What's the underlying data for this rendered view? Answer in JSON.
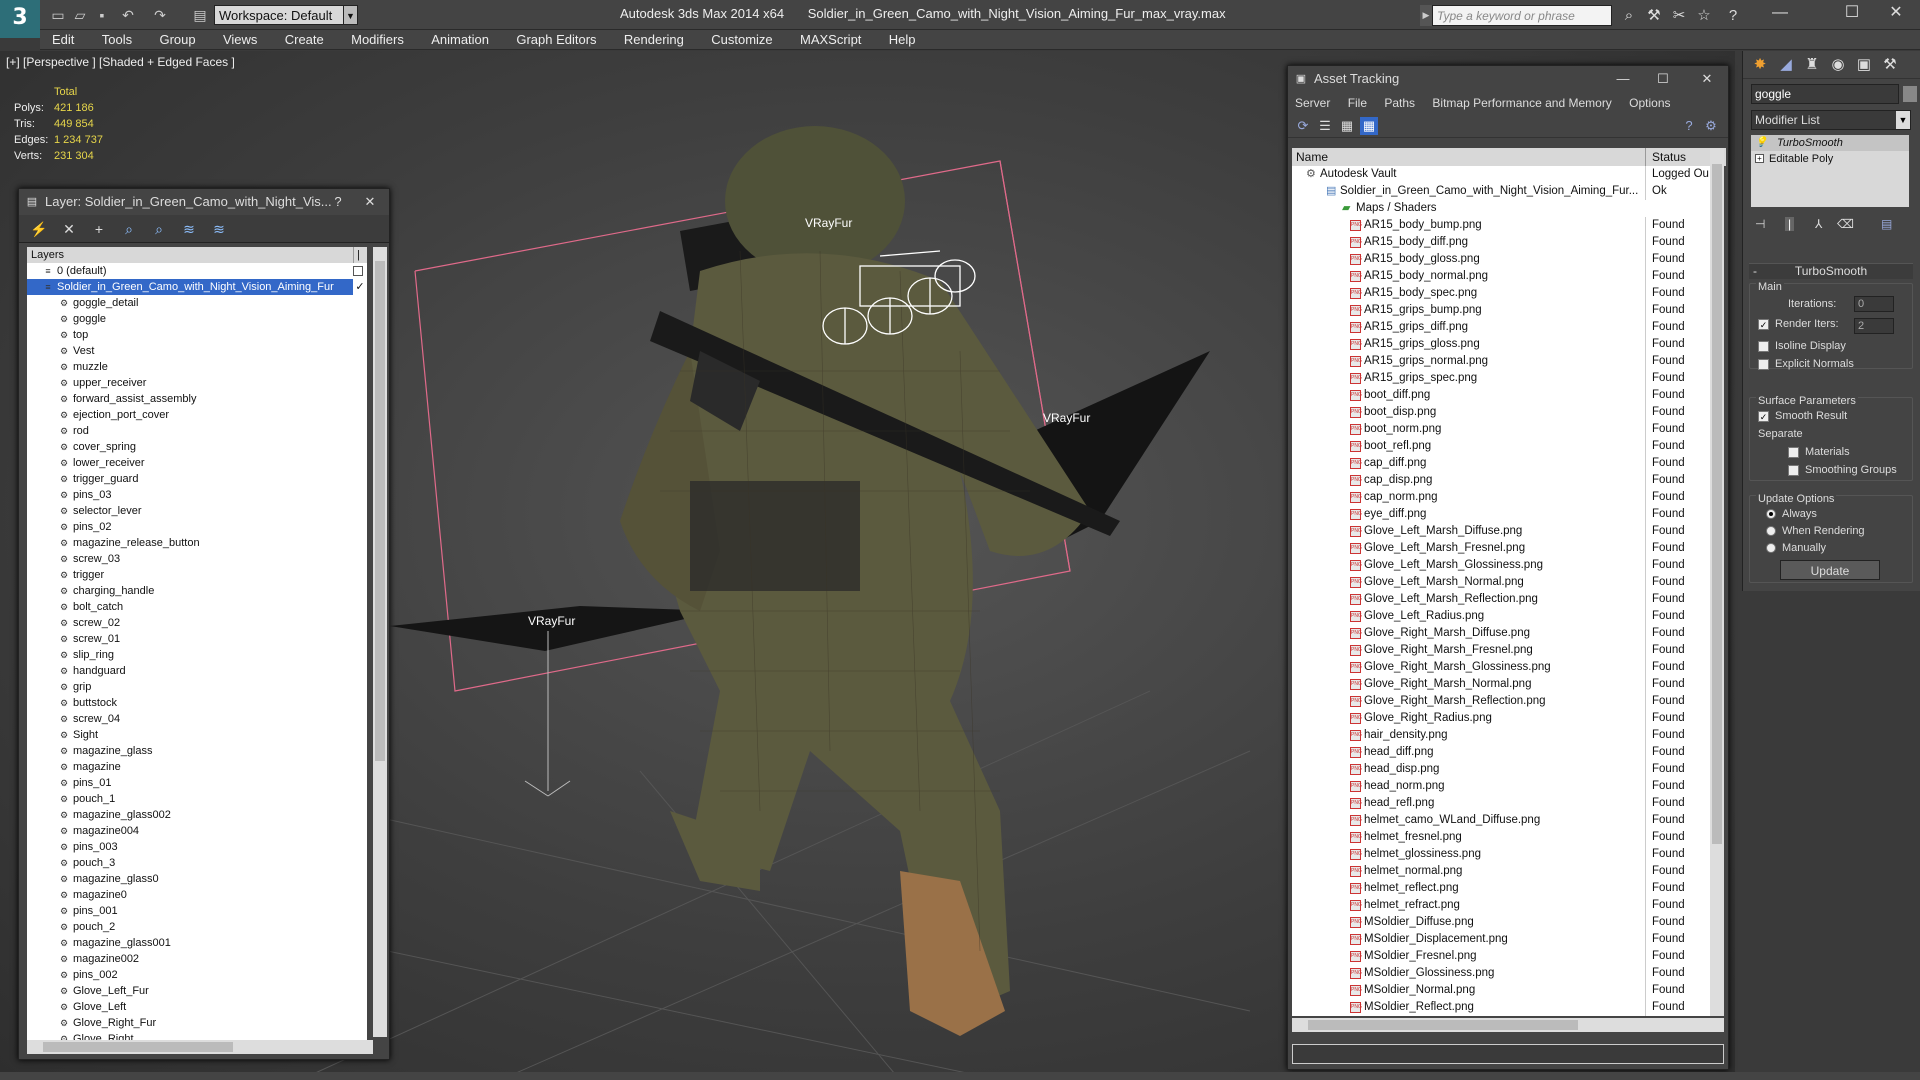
{
  "title": {
    "app": "Autodesk 3ds Max 2014 x64",
    "file": "Soldier_in_Green_Camo_with_Night_Vision_Aiming_Fur_max_vray.max"
  },
  "workspace": "Workspace: Default",
  "search": {
    "placeholder": "Type a keyword or phrase"
  },
  "menu": [
    "Edit",
    "Tools",
    "Group",
    "Views",
    "Create",
    "Modifiers",
    "Animation",
    "Graph Editors",
    "Rendering",
    "Customize",
    "MAXScript",
    "Help"
  ],
  "viewport": {
    "label": "[+] [Perspective ] [Shaded + Edged Faces ]",
    "stats": {
      "header": "Total",
      "polys_label": "Polys:",
      "polys": "421 186",
      "tris_label": "Tris:",
      "tris": "449 854",
      "edges_label": "Edges:",
      "edges": "1 234 737",
      "verts_label": "Verts:",
      "verts": "231 304"
    },
    "vray_labels": [
      "VRayFur",
      "VRayFur",
      "VRayFur"
    ]
  },
  "layer_panel": {
    "title": "Layer: Soldier_in_Green_Camo_with_Night_Vis...",
    "help": "?",
    "column": "Layers",
    "items": [
      {
        "label": "0 (default)",
        "kind": "layer"
      },
      {
        "label": "Soldier_in_Green_Camo_with_Night_Vision_Aiming_Fur",
        "kind": "layer-active"
      },
      {
        "label": "goggle_detail"
      },
      {
        "label": "goggle"
      },
      {
        "label": "top"
      },
      {
        "label": "Vest"
      },
      {
        "label": "muzzle"
      },
      {
        "label": "upper_receiver"
      },
      {
        "label": "forward_assist_assembly"
      },
      {
        "label": "ejection_port_cover"
      },
      {
        "label": "rod"
      },
      {
        "label": "cover_spring"
      },
      {
        "label": "lower_receiver"
      },
      {
        "label": "trigger_guard"
      },
      {
        "label": "pins_03"
      },
      {
        "label": "selector_lever"
      },
      {
        "label": "pins_02"
      },
      {
        "label": "magazine_release_button"
      },
      {
        "label": "screw_03"
      },
      {
        "label": "trigger"
      },
      {
        "label": "charging_handle"
      },
      {
        "label": "bolt_catch"
      },
      {
        "label": "screw_02"
      },
      {
        "label": "screw_01"
      },
      {
        "label": "slip_ring"
      },
      {
        "label": "handguard"
      },
      {
        "label": "grip"
      },
      {
        "label": "buttstock"
      },
      {
        "label": "screw_04"
      },
      {
        "label": "Sight"
      },
      {
        "label": "magazine_glass"
      },
      {
        "label": "magazine"
      },
      {
        "label": "pins_01"
      },
      {
        "label": "pouch_1"
      },
      {
        "label": "magazine_glass002"
      },
      {
        "label": "magazine004"
      },
      {
        "label": "pins_003"
      },
      {
        "label": "pouch_3"
      },
      {
        "label": "magazine_glass0"
      },
      {
        "label": "magazine0"
      },
      {
        "label": "pins_001"
      },
      {
        "label": "pouch_2"
      },
      {
        "label": "magazine_glass001"
      },
      {
        "label": "magazine002"
      },
      {
        "label": "pins_002"
      },
      {
        "label": "Glove_Left_Fur"
      },
      {
        "label": "Glove_Left"
      },
      {
        "label": "Glove_Right_Fur"
      },
      {
        "label": "Glove_Right"
      }
    ]
  },
  "asset_tracking": {
    "title": "Asset Tracking",
    "menu": [
      "Server",
      "File",
      "Paths",
      "Bitmap Performance and Memory",
      "Options"
    ],
    "columns": {
      "name": "Name",
      "status": "Status"
    },
    "rows": [
      {
        "name": "Autodesk Vault",
        "status": "Logged Ou",
        "indent": 0,
        "kind": "vault"
      },
      {
        "name": "Soldier_in_Green_Camo_with_Night_Vision_Aiming_Fur...",
        "status": "Ok",
        "indent": 1,
        "kind": "file"
      },
      {
        "name": "Maps / Shaders",
        "status": "",
        "indent": 2,
        "kind": "folder"
      },
      {
        "name": "AR15_body_bump.png",
        "status": "Found",
        "indent": 3
      },
      {
        "name": "AR15_body_diff.png",
        "status": "Found",
        "indent": 3
      },
      {
        "name": "AR15_body_gloss.png",
        "status": "Found",
        "indent": 3
      },
      {
        "name": "AR15_body_normal.png",
        "status": "Found",
        "indent": 3
      },
      {
        "name": "AR15_body_spec.png",
        "status": "Found",
        "indent": 3
      },
      {
        "name": "AR15_grips_bump.png",
        "status": "Found",
        "indent": 3
      },
      {
        "name": "AR15_grips_diff.png",
        "status": "Found",
        "indent": 3
      },
      {
        "name": "AR15_grips_gloss.png",
        "status": "Found",
        "indent": 3
      },
      {
        "name": "AR15_grips_normal.png",
        "status": "Found",
        "indent": 3
      },
      {
        "name": "AR15_grips_spec.png",
        "status": "Found",
        "indent": 3
      },
      {
        "name": "boot_diff.png",
        "status": "Found",
        "indent": 3
      },
      {
        "name": "boot_disp.png",
        "status": "Found",
        "indent": 3
      },
      {
        "name": "boot_norm.png",
        "status": "Found",
        "indent": 3
      },
      {
        "name": "boot_refl.png",
        "status": "Found",
        "indent": 3
      },
      {
        "name": "cap_diff.png",
        "status": "Found",
        "indent": 3
      },
      {
        "name": "cap_disp.png",
        "status": "Found",
        "indent": 3
      },
      {
        "name": "cap_norm.png",
        "status": "Found",
        "indent": 3
      },
      {
        "name": "eye_diff.png",
        "status": "Found",
        "indent": 3
      },
      {
        "name": "Glove_Left_Marsh_Diffuse.png",
        "status": "Found",
        "indent": 3
      },
      {
        "name": "Glove_Left_Marsh_Fresnel.png",
        "status": "Found",
        "indent": 3
      },
      {
        "name": "Glove_Left_Marsh_Glossiness.png",
        "status": "Found",
        "indent": 3
      },
      {
        "name": "Glove_Left_Marsh_Normal.png",
        "status": "Found",
        "indent": 3
      },
      {
        "name": "Glove_Left_Marsh_Reflection.png",
        "status": "Found",
        "indent": 3
      },
      {
        "name": "Glove_Left_Radius.png",
        "status": "Found",
        "indent": 3
      },
      {
        "name": "Glove_Right_Marsh_Diffuse.png",
        "status": "Found",
        "indent": 3
      },
      {
        "name": "Glove_Right_Marsh_Fresnel.png",
        "status": "Found",
        "indent": 3
      },
      {
        "name": "Glove_Right_Marsh_Glossiness.png",
        "status": "Found",
        "indent": 3
      },
      {
        "name": "Glove_Right_Marsh_Normal.png",
        "status": "Found",
        "indent": 3
      },
      {
        "name": "Glove_Right_Marsh_Reflection.png",
        "status": "Found",
        "indent": 3
      },
      {
        "name": "Glove_Right_Radius.png",
        "status": "Found",
        "indent": 3
      },
      {
        "name": "hair_density.png",
        "status": "Found",
        "indent": 3
      },
      {
        "name": "head_diff.png",
        "status": "Found",
        "indent": 3
      },
      {
        "name": "head_disp.png",
        "status": "Found",
        "indent": 3
      },
      {
        "name": "head_norm.png",
        "status": "Found",
        "indent": 3
      },
      {
        "name": "head_refl.png",
        "status": "Found",
        "indent": 3
      },
      {
        "name": "helmet_camo_WLand_Diffuse.png",
        "status": "Found",
        "indent": 3
      },
      {
        "name": "helmet_fresnel.png",
        "status": "Found",
        "indent": 3
      },
      {
        "name": "helmet_glossiness.png",
        "status": "Found",
        "indent": 3
      },
      {
        "name": "helmet_normal.png",
        "status": "Found",
        "indent": 3
      },
      {
        "name": "helmet_reflect.png",
        "status": "Found",
        "indent": 3
      },
      {
        "name": "helmet_refract.png",
        "status": "Found",
        "indent": 3
      },
      {
        "name": "MSoldier_Diffuse.png",
        "status": "Found",
        "indent": 3
      },
      {
        "name": "MSoldier_Displacement.png",
        "status": "Found",
        "indent": 3
      },
      {
        "name": "MSoldier_Fresnel.png",
        "status": "Found",
        "indent": 3
      },
      {
        "name": "MSoldier_Glossiness.png",
        "status": "Found",
        "indent": 3
      },
      {
        "name": "MSoldier_Normal.png",
        "status": "Found",
        "indent": 3
      },
      {
        "name": "MSoldier_Reflect.png",
        "status": "Found",
        "indent": 3
      }
    ]
  },
  "command_panel": {
    "object_name": "goggle",
    "modifier_list": "Modifier List",
    "stack": [
      "TurboSmooth",
      "Editable Poly"
    ],
    "rollout_title": "TurboSmooth",
    "main": "Main",
    "iterations_label": "Iterations:",
    "iterations": "0",
    "render_iters_label": "Render Iters:",
    "render_iters": "2",
    "isoline": "Isoline Display",
    "explicit": "Explicit Normals",
    "surface": "Surface Parameters",
    "smooth_result": "Smooth Result",
    "separate": "Separate",
    "materials": "Materials",
    "smoothing_groups": "Smoothing Groups",
    "update_options": "Update Options",
    "always": "Always",
    "when_rendering": "When Rendering",
    "manually": "Manually",
    "update_btn": "Update"
  }
}
